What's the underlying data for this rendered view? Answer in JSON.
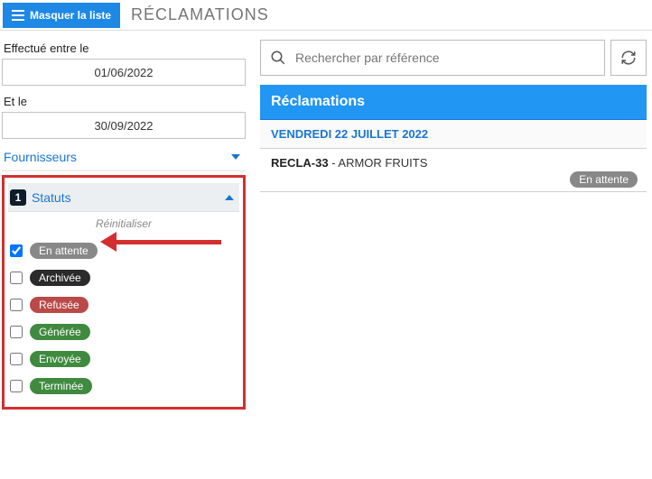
{
  "header": {
    "hide_list_label": "Masquer la liste",
    "page_title": "RÉCLAMATIONS"
  },
  "filters": {
    "date_from_label": "Effectué entre le",
    "date_from_value": "01/06/2022",
    "date_to_label": "Et le",
    "date_to_value": "30/09/2022",
    "suppliers_label": "Fournisseurs"
  },
  "status_filter": {
    "count": "1",
    "title": "Statuts",
    "reset_label": "Réinitialiser",
    "items": [
      {
        "label": "En attente",
        "color": "gray",
        "checked": true
      },
      {
        "label": "Archivée",
        "color": "dark",
        "checked": false
      },
      {
        "label": "Refusée",
        "color": "red",
        "checked": false
      },
      {
        "label": "Générée",
        "color": "green",
        "checked": false
      },
      {
        "label": "Envoyée",
        "color": "green",
        "checked": false
      },
      {
        "label": "Terminée",
        "color": "green",
        "checked": false
      }
    ]
  },
  "search": {
    "placeholder": "Rechercher par référence"
  },
  "panel": {
    "title": "Réclamations"
  },
  "results": {
    "date_header": "VENDREDI 22 JUILLET 2022",
    "item_code": "RECLA-33",
    "item_sep": "  -  ",
    "item_name": "ARMOR FRUITS",
    "item_status": "En attente"
  }
}
